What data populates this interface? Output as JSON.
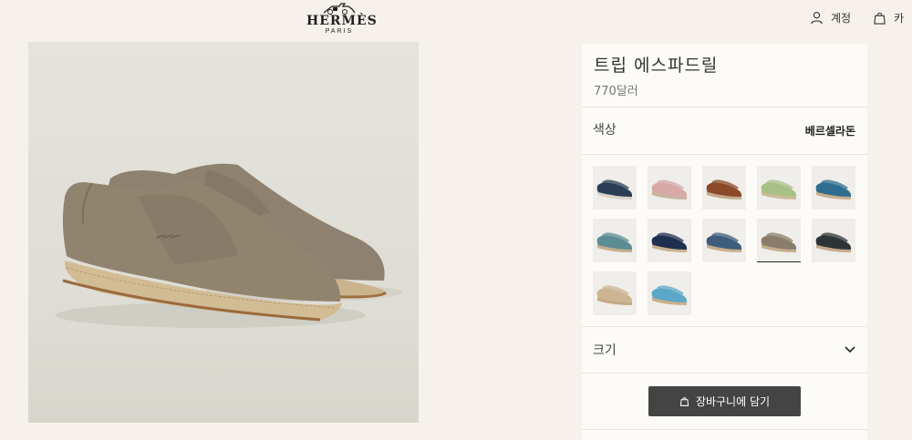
{
  "header": {
    "brand": "HERMÈS",
    "city": "PARIS",
    "account_label": "계정",
    "cart_label": "카"
  },
  "product": {
    "title": "트립 에스파드릴",
    "price": "770달러"
  },
  "color": {
    "label": "색상",
    "selected": "베르셀라돈",
    "swatches": [
      {
        "icon": "navy-white-espadrille",
        "top": "#2a3d55",
        "bottom": "#d9d3c4"
      },
      {
        "icon": "pink-espadrille",
        "top": "#d6a9a7",
        "bottom": "#c9b49f"
      },
      {
        "icon": "brown-espadrille",
        "top": "#8a4a2a",
        "bottom": "#c5a98c"
      },
      {
        "icon": "green-espadrille",
        "top": "#a8bf85",
        "bottom": "#cdbb99"
      },
      {
        "icon": "blue-espadrille",
        "top": "#2f6d8f",
        "bottom": "#c7ae8c"
      },
      {
        "icon": "teal-espadrille",
        "top": "#5c8c94",
        "bottom": "#c5ae8d"
      },
      {
        "icon": "navy-espadrille",
        "top": "#1f2f4f",
        "bottom": "#c9b08f"
      },
      {
        "icon": "denim-espadrille",
        "top": "#3e5d7c",
        "bottom": "#c8ae8c"
      },
      {
        "icon": "taupe-espadrille",
        "top": "#8b7d6b",
        "bottom": "#c6ad8c"
      },
      {
        "icon": "charcoal-espadrille",
        "top": "#2e3436",
        "bottom": "#c4ab8a"
      },
      {
        "icon": "beige-espadrille",
        "top": "#cdb593",
        "bottom": "#c4a985"
      },
      {
        "icon": "sky-blue-espadrille",
        "top": "#5da7c8",
        "bottom": "#c9b08c"
      }
    ],
    "selected_index": 8
  },
  "size": {
    "label": "크기"
  },
  "cart": {
    "button_label": "장바구니에 담기"
  }
}
